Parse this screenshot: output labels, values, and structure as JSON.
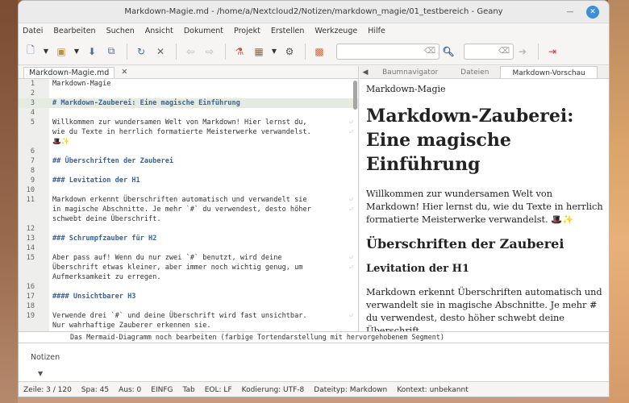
{
  "window": {
    "title": "Markdown-Magie.md - /home/a/Nextcloud2/Notizen/markdown_magie/01_testbereich - Geany"
  },
  "menu": [
    "Datei",
    "Bearbeiten",
    "Suchen",
    "Ansicht",
    "Dokument",
    "Projekt",
    "Erstellen",
    "Werkzeuge",
    "Hilfe"
  ],
  "toolbar": {
    "search_value": "",
    "goto_value": ""
  },
  "doc_tab": {
    "label": "Markdown-Magie.md"
  },
  "editor": {
    "lines": [
      {
        "n": "1",
        "text": "Markdown-Magie",
        "kind": "plain"
      },
      {
        "n": "2",
        "text": "",
        "kind": "plain"
      },
      {
        "n": "3",
        "text": "# Markdown-Zauberei: Eine magische Einführung",
        "kind": "head",
        "hl": true
      },
      {
        "n": "4",
        "text": "",
        "kind": "plain"
      },
      {
        "n": "5",
        "text": "Willkommen zur wundersamen Welt von Markdown! Hier lernst du,",
        "kind": "plain",
        "wrap": true
      },
      {
        "n": "",
        "text": "wie du Texte in herrlich formatierte Meisterwerke verwandelst.",
        "kind": "plain",
        "wrap": true
      },
      {
        "n": "",
        "text": "🎩✨",
        "kind": "plain"
      },
      {
        "n": "6",
        "text": "",
        "kind": "plain"
      },
      {
        "n": "7",
        "text": "## Überschriften der Zauberei",
        "kind": "head"
      },
      {
        "n": "8",
        "text": "",
        "kind": "plain"
      },
      {
        "n": "9",
        "text": "### Levitation der H1",
        "kind": "head"
      },
      {
        "n": "10",
        "text": "",
        "kind": "plain"
      },
      {
        "n": "11",
        "text": "Markdown erkennt Überschriften automatisch und verwandelt sie",
        "kind": "plain",
        "wrap": true
      },
      {
        "n": "",
        "text": "in magische Abschnitte. Je mehr `#` du verwendest, desto höher",
        "kind": "plain",
        "wrap": true
      },
      {
        "n": "",
        "text": "schwebt deine Überschrift.",
        "kind": "plain"
      },
      {
        "n": "12",
        "text": "",
        "kind": "plain"
      },
      {
        "n": "13",
        "text": "### Schrumpfzauber für H2",
        "kind": "head"
      },
      {
        "n": "14",
        "text": "",
        "kind": "plain"
      },
      {
        "n": "15",
        "text": "Aber pass auf! Wenn du nur zwei `#` benutzt, wird deine",
        "kind": "plain",
        "wrap": true
      },
      {
        "n": "",
        "text": "Überschrift etwas kleiner, aber immer noch wichtig genug, um",
        "kind": "plain",
        "wrap": true
      },
      {
        "n": "",
        "text": "Aufmerksamkeit zu erregen.",
        "kind": "plain"
      },
      {
        "n": "16",
        "text": "",
        "kind": "plain"
      },
      {
        "n": "17",
        "text": "#### Unsichtbarer H3",
        "kind": "head"
      },
      {
        "n": "18",
        "text": "",
        "kind": "plain"
      },
      {
        "n": "19",
        "text": "Verwende drei `#` und deine Überschrift wird fast unsichtbar.",
        "kind": "plain",
        "wrap": true
      },
      {
        "n": "",
        "text": "Nur wahrhaftige Zauberer erkennen sie.",
        "kind": "plain"
      }
    ]
  },
  "side_tabs": [
    "Baumnavigator",
    "Dateien",
    "Markdown-Vorschau"
  ],
  "preview": {
    "p0": "Markdown-Magie",
    "h1": "Markdown-Zauberei: Eine magische Einführung",
    "p1": "Willkommen zur wundersamen Welt von Markdown! Hier lernst du, wie du Texte in herrlich formatierte Meisterwerke verwandelst. 🎩✨",
    "h2": "Überschriften der Zauberei",
    "h3": "Levitation der H1",
    "p2": "Markdown erkennt Überschriften automatisch und verwandelt sie in magische Abschnitte. Je mehr # du verwendest, desto höher schwebt deine Überschrift."
  },
  "message_line": "Das Mermaid-Diagramm noch bearbeiten (farbige Tortendarstellung mit hervorgehobenem Segment)",
  "message_tab": "Notizen",
  "status": {
    "line": "Zeile: 3 / 120",
    "col": "Spa: 45",
    "sel": "Aus: 0",
    "mode": "EINFG",
    "tab": "Tab",
    "eol": "EOL: LF",
    "enc": "Kodierung: UTF-8",
    "ftype": "Dateityp: Markdown",
    "ctx": "Kontext: unbekannt"
  }
}
